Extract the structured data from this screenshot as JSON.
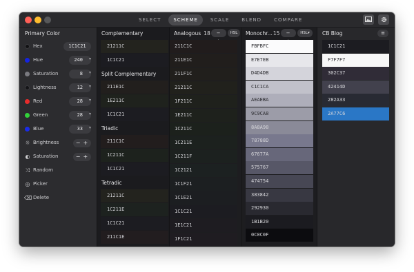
{
  "toolbar": {
    "modes": [
      {
        "label": "SELECT",
        "active": false
      },
      {
        "label": "SCHEME",
        "active": true
      },
      {
        "label": "SCALE",
        "active": false
      },
      {
        "label": "BLEND",
        "active": false
      },
      {
        "label": "COMPARE",
        "active": false
      }
    ],
    "image_icon": "image-icon",
    "settings_icon": "gear-icon"
  },
  "sidebar": {
    "title": "Primary Color",
    "hex": {
      "label": "Hex",
      "value": "1C1C21",
      "dot_color": "#1c1c21"
    },
    "channels": [
      {
        "label": "Hue",
        "value": "240",
        "dot_color": "#1524e0"
      },
      {
        "label": "Saturation",
        "value": "8",
        "dot_color": "#7a7a80"
      },
      {
        "label": "Lightness",
        "value": "12",
        "dot_color": "#1c1c21"
      },
      {
        "label": "Red",
        "value": "28",
        "dot_color": "#e82c2c"
      },
      {
        "label": "Green",
        "value": "28",
        "dot_color": "#33d23a"
      },
      {
        "label": "Blue",
        "value": "33",
        "dot_color": "#1a2ce8"
      }
    ],
    "adjusters": [
      {
        "label": "Brightness",
        "icon": "sun-icon"
      },
      {
        "label": "Saturation",
        "icon": "half-circle-icon"
      }
    ],
    "actions": [
      {
        "label": "Random",
        "icon": "shuffle-icon"
      },
      {
        "label": "Picker",
        "icon": "target-icon"
      },
      {
        "label": "Delete",
        "icon": "trash-icon"
      }
    ]
  },
  "scheme": {
    "sections": [
      {
        "title": "Complementary",
        "swatches": [
          "21211C",
          "1C1C21"
        ]
      },
      {
        "title": "Split Complementary",
        "swatches": [
          "211E1C",
          "1E211C",
          "1C1C21"
        ]
      },
      {
        "title": "Triadic",
        "swatches": [
          "211C1C",
          "1C211C",
          "1C1C21"
        ]
      },
      {
        "title": "Tetradic",
        "swatches": [
          "21211C",
          "1C211E",
          "1C1C21",
          "211C1E"
        ]
      }
    ]
  },
  "analogous": {
    "title": "Analogous",
    "count": "18",
    "format": "HSL",
    "swatches": [
      "211C1C",
      "211E1C",
      "211F1C",
      "21211C",
      "1F211C",
      "1E211C",
      "1C211C",
      "1C211E",
      "1C211F",
      "1C2121",
      "1C1F21",
      "1C1E21",
      "1C1C21",
      "1E1C21",
      "1F1C21"
    ]
  },
  "monochromatic": {
    "title": "Monochr...",
    "count": "15",
    "format": "HSL",
    "swatches": [
      {
        "hex": "FBFBFC",
        "color": "#fbfbfc"
      },
      {
        "hex": "E7E7EB",
        "color": "#e7e7eb"
      },
      {
        "hex": "D4D4DB",
        "color": "#d4d4db"
      },
      {
        "hex": "C1C1CA",
        "color": "#c1c1ca"
      },
      {
        "hex": "AEAEBA",
        "color": "#aeaeba"
      },
      {
        "hex": "9C9CA8",
        "color": "#9c9ca8"
      },
      {
        "hex": "8A8A98",
        "color": "#8a8a98"
      },
      {
        "hex": "78788D",
        "color": "#78788d"
      },
      {
        "hex": "67677A",
        "color": "#67677a"
      },
      {
        "hex": "575767",
        "color": "#575767"
      },
      {
        "hex": "474754",
        "color": "#474754"
      },
      {
        "hex": "383842",
        "color": "#383842"
      },
      {
        "hex": "292930",
        "color": "#292930"
      },
      {
        "hex": "1B1B20",
        "color": "#1b1b20"
      },
      {
        "hex": "0C0C0F",
        "color": "#0c0c0f"
      }
    ]
  },
  "palette": {
    "title": "CB Blog",
    "swatches": [
      {
        "hex": "1C1C21",
        "color": "#1c1c21"
      },
      {
        "hex": "F7F7F7",
        "color": "#f7f7f7"
      },
      {
        "hex": "302C37",
        "color": "#302c37"
      },
      {
        "hex": "42414D",
        "color": "#42414d"
      },
      {
        "hex": "282A33",
        "color": "#282a33"
      },
      {
        "hex": "2A77C6",
        "color": "#2a77c6"
      }
    ]
  }
}
